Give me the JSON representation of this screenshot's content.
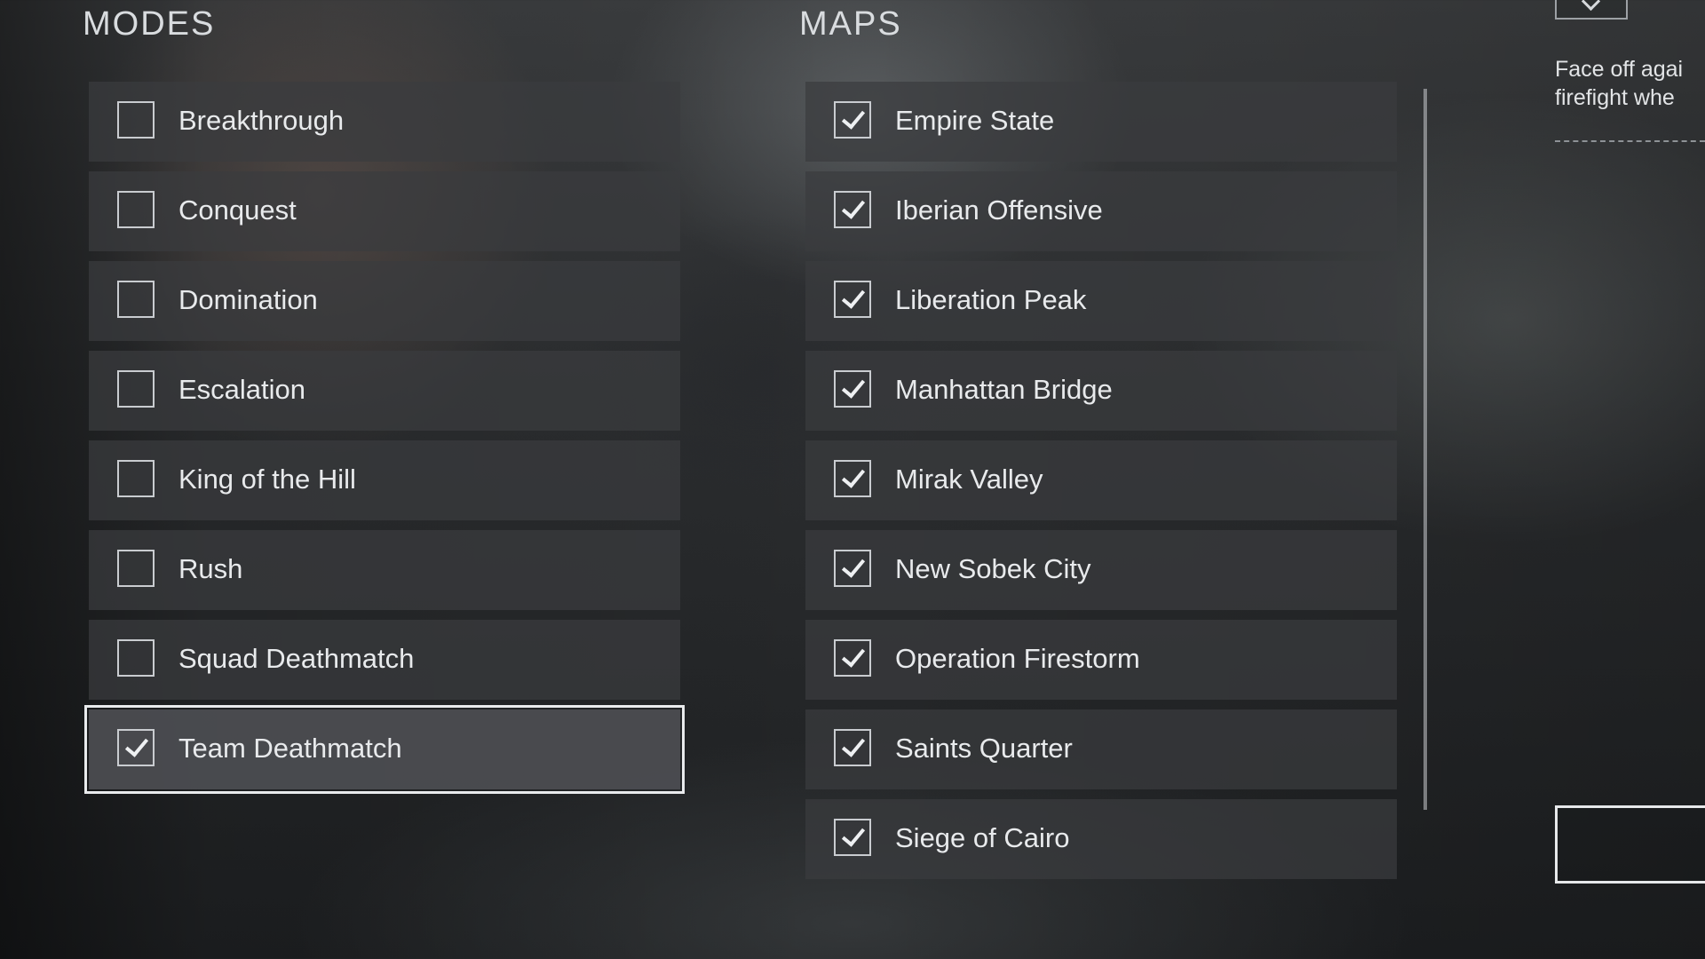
{
  "modes": {
    "title": "MODES",
    "items": [
      {
        "label": "Breakthrough",
        "checked": false
      },
      {
        "label": "Conquest",
        "checked": false
      },
      {
        "label": "Domination",
        "checked": false
      },
      {
        "label": "Escalation",
        "checked": false
      },
      {
        "label": "King of the Hill",
        "checked": false
      },
      {
        "label": "Rush",
        "checked": false
      },
      {
        "label": "Squad Deathmatch",
        "checked": false
      },
      {
        "label": "Team Deathmatch",
        "checked": true,
        "selected": true
      }
    ]
  },
  "maps": {
    "title": "MAPS",
    "items": [
      {
        "label": "Empire State",
        "checked": true
      },
      {
        "label": "Iberian Offensive",
        "checked": true
      },
      {
        "label": "Liberation Peak",
        "checked": true
      },
      {
        "label": "Manhattan Bridge",
        "checked": true
      },
      {
        "label": "Mirak Valley",
        "checked": true
      },
      {
        "label": "New Sobek City",
        "checked": true
      },
      {
        "label": "Operation Firestorm",
        "checked": true
      },
      {
        "label": "Saints Quarter",
        "checked": true
      },
      {
        "label": "Siege of Cairo",
        "checked": true
      }
    ]
  },
  "details": {
    "description": "Face off agai\nfirefight whe"
  },
  "icons": {
    "dropdown": "chevron-down-icon",
    "check": "checkmark-icon"
  },
  "colors": {
    "row_background": "#3a3c3f",
    "selected_outline": "#e9ebed",
    "text": "#e8eaec"
  }
}
